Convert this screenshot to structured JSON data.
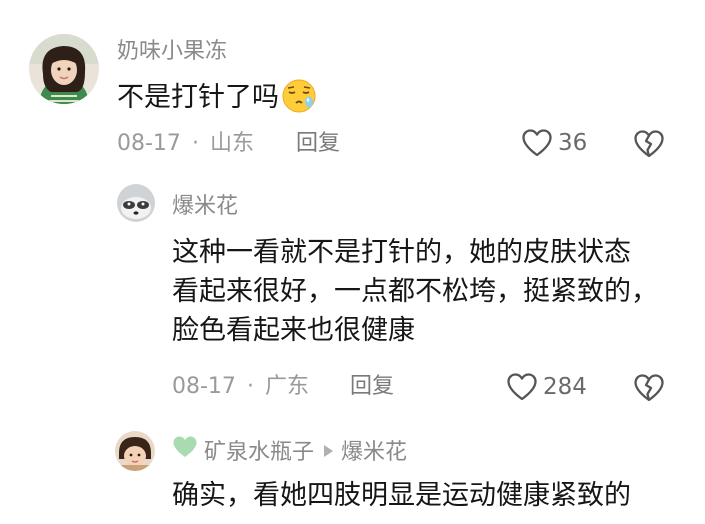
{
  "comments": [
    {
      "author": "奶味小果冻",
      "text": "不是打针了吗",
      "emoji": "sleepy-face-emoji",
      "date": "08-17",
      "separator": "·",
      "location": "山东",
      "reply_label": "回复",
      "likes": "36"
    },
    {
      "author": "爆米花",
      "text_lines": [
        "这种一看就不是打针的，她的皮肤状态",
        "看起来很好，一点都不松垮，挺紧致的，",
        "脸色看起来也很健康"
      ],
      "date": "08-17",
      "separator": "·",
      "location": "广东",
      "reply_label": "回复",
      "likes": "284"
    },
    {
      "author": "矿泉水瓶子",
      "reply_to": "爆米花",
      "text": "确实，看她四肢明显是运动健康紧致的"
    }
  ],
  "colors": {
    "name": "#8a8a8a",
    "text": "#161616",
    "meta": "#9a9a9a",
    "badge_heart": "#a8dcb0"
  }
}
